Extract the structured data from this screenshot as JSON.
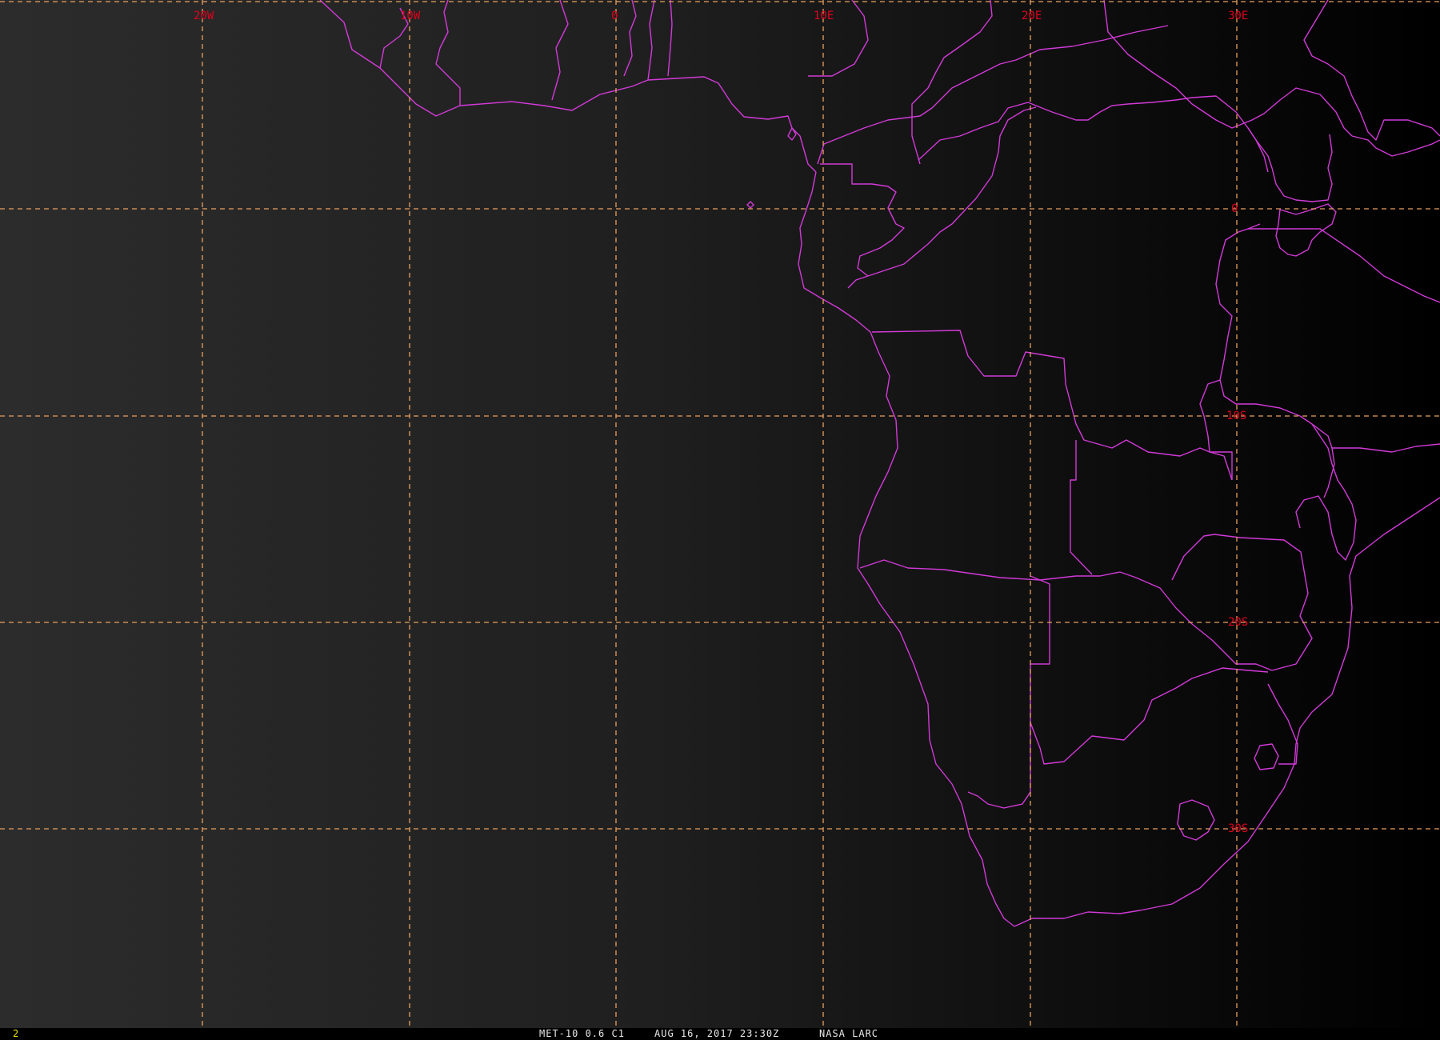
{
  "map": {
    "colors": {
      "background_light": "#2e2e2e",
      "background_dark": "#000000",
      "gridlines": "#e8a060",
      "grid_labels": "#e0001e",
      "boundaries": "#d23ad8",
      "frame_number": "#e8e000"
    },
    "longitude_labels": [
      "20W",
      "10W",
      "0",
      "10E",
      "20E",
      "30E"
    ],
    "latitude_labels": [
      "0",
      "10S",
      "20S",
      "30S"
    ]
  },
  "status": {
    "frame_number": "2",
    "satellite": "MET-10 0.6 C1",
    "datetime": "AUG 16, 2017 23:30Z",
    "agency": "NASA LARC"
  }
}
